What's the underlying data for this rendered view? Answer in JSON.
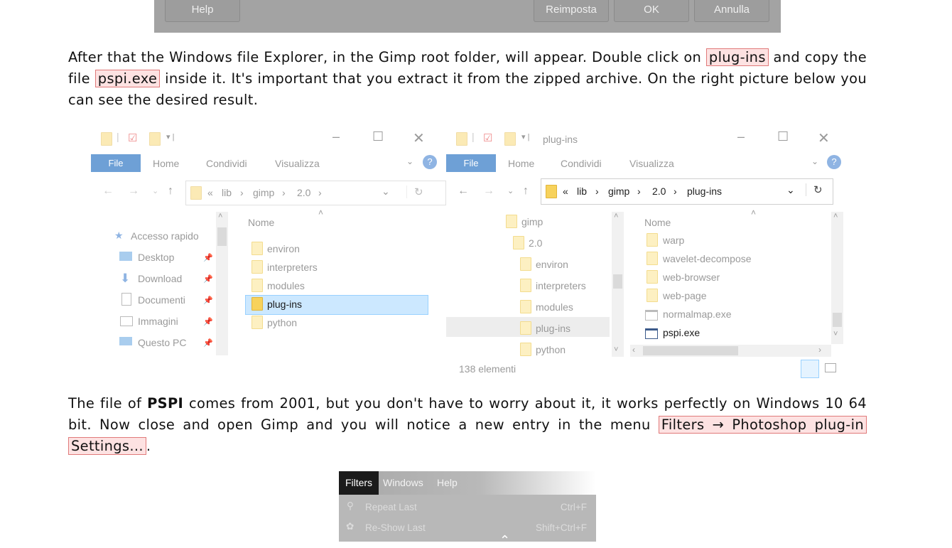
{
  "dialog_buttons": {
    "help": "Help",
    "reset": "Reimposta",
    "ok": "OK",
    "cancel": "Annulla"
  },
  "para1": {
    "t1": "After that the Windows file Explorer, in the Gimp root folder, will appear. Double click on ",
    "c1": "plug-ins",
    "t2": " and copy the file ",
    "c2": "pspi.exe",
    "t3": " inside it. It's important that you extract it from the zipped archive. On the right picture below you can see the desired result."
  },
  "explorer_left": {
    "title": "",
    "ribbon": [
      "File",
      "Home",
      "Condividi",
      "Visualizza"
    ],
    "path": [
      "«",
      "lib",
      "gimp",
      "2.0"
    ],
    "column_header": "Nome",
    "nav": [
      "Accesso rapido",
      "Desktop",
      "Download",
      "Documenti",
      "Immagini",
      "Questo PC"
    ],
    "folders": [
      "environ",
      "interpreters",
      "modules",
      "plug-ins",
      "python"
    ]
  },
  "explorer_right": {
    "title": "plug-ins",
    "ribbon": [
      "File",
      "Home",
      "Condividi",
      "Visualizza"
    ],
    "path": [
      "«",
      "lib",
      "gimp",
      "2.0",
      "plug-ins"
    ],
    "column_header": "Nome",
    "tree": [
      "gimp",
      "2.0",
      "environ",
      "interpreters",
      "modules",
      "plug-ins",
      "python"
    ],
    "files": [
      "warp",
      "wavelet-decompose",
      "web-browser",
      "web-page",
      "normalmap.exe",
      "pspi.exe"
    ],
    "status": "138 elementi"
  },
  "para2": {
    "t1": "The file of ",
    "b1": "PSPI",
    "t2": " comes from 2001, but you don't have to worry about it, it works perfectly on Windows 10 64 bit. Now close and open Gimp and you will notice a new entry in the menu ",
    "c1a": "Filters → Photoshop plug-in",
    "c1b": "Settings...",
    "t3": "."
  },
  "gimp_menu": {
    "bar": [
      "Filters",
      "Windows",
      "Help"
    ],
    "items": [
      {
        "label": "Repeat Last",
        "shortcut": "Ctrl+F"
      },
      {
        "label": "Re-Show Last",
        "shortcut": "Shift+Ctrl+F"
      }
    ]
  },
  "colors": {
    "highlight_bg": "#fde2e2",
    "highlight_border": "#e07a7a",
    "file_tab": "#6ea0d6",
    "selection": "#cce8ff"
  }
}
